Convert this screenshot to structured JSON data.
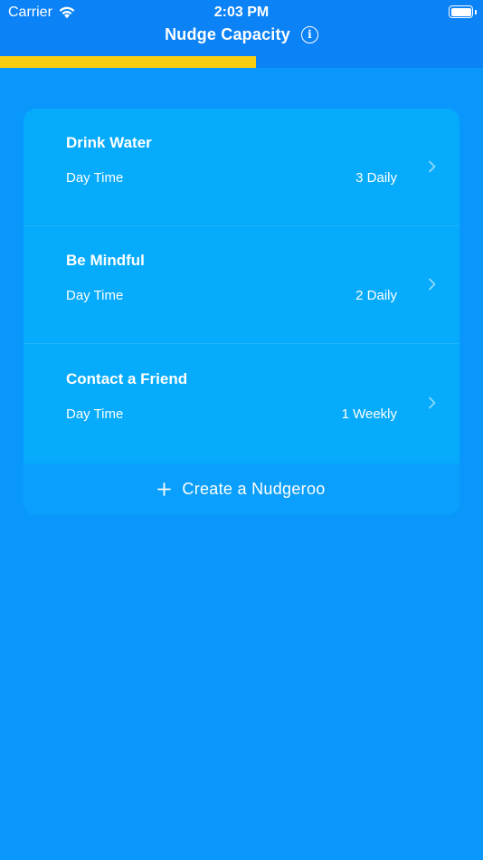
{
  "status_bar": {
    "carrier": "Carrier",
    "time": "2:03 PM",
    "wifi_icon": "wifi-icon",
    "battery_icon": "battery-icon"
  },
  "nav": {
    "title": "Nudge Capacity",
    "info_icon": "info-icon",
    "info_glyph": "i"
  },
  "capacity": {
    "fill_fraction": 0.53,
    "color": "#f6cd11"
  },
  "nudges": [
    {
      "title": "Drink Water",
      "when": "Day Time",
      "frequency": "3 Daily"
    },
    {
      "title": "Be Mindful",
      "when": "Day Time",
      "frequency": "2 Daily"
    },
    {
      "title": "Contact a Friend",
      "when": "Day Time",
      "frequency": "1 Weekly"
    }
  ],
  "create_button": {
    "label": "Create a Nudgeroo",
    "icon": "plus-icon"
  },
  "colors": {
    "background": "#0a97fb",
    "nav_background": "#0b82f6",
    "card": "#06abfc",
    "create_row": "#0a9ffc",
    "accent_bar": "#f6cd11"
  }
}
